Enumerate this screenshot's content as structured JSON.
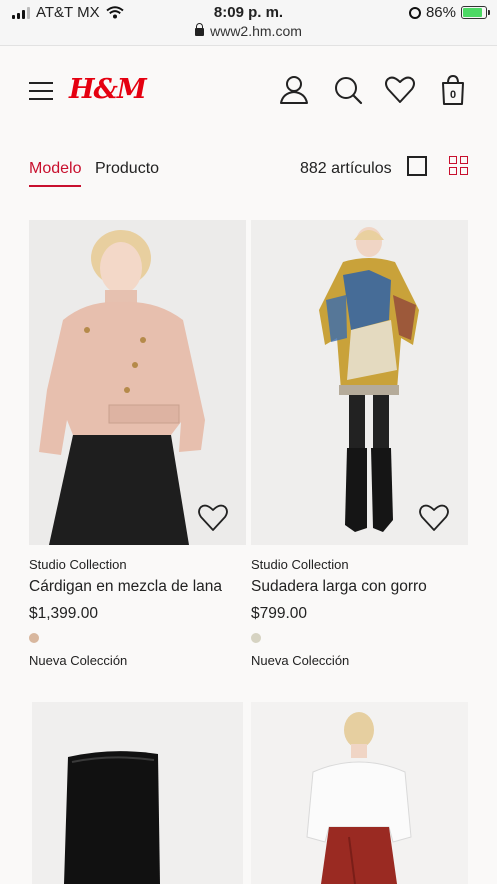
{
  "status_bar": {
    "carrier": "AT&T MX",
    "time": "8:09 p. m.",
    "url": "www2.hm.com",
    "battery": "86%",
    "battery_level": 0.86
  },
  "header": {
    "logo": "H&M",
    "cart_count": "0",
    "icons": [
      "menu-icon",
      "account-icon",
      "search-icon",
      "favorites-icon",
      "shopping-bag-icon"
    ]
  },
  "filter": {
    "tab_model": "Modelo",
    "tab_product": "Producto",
    "count": "882 artículos"
  },
  "products": [
    {
      "brand": "Studio Collection",
      "name": "Cárdigan en mezcla de lana",
      "price": "$1,399.00",
      "swatch_color": "#d8b79e",
      "badge": "Nueva Colección"
    },
    {
      "brand": "Studio Collection",
      "name": "Sudadera larga con gorro",
      "price": "$799.00",
      "swatch_color": "#d6d3c2",
      "badge": "Nueva Colección"
    },
    {},
    {}
  ],
  "colors": {
    "accent": "#c8102e",
    "brand": "#e50010"
  }
}
